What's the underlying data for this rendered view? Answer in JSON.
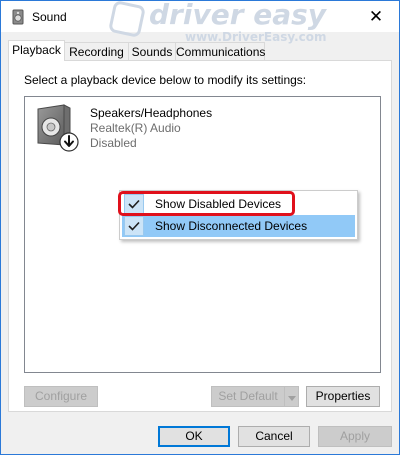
{
  "window": {
    "title": "Sound",
    "close_glyph": "✕"
  },
  "watermark": {
    "brand": "driver easy",
    "url": "www.DriverEasy.com"
  },
  "tabs": [
    {
      "label": "Playback",
      "active": true
    },
    {
      "label": "Recording",
      "active": false
    },
    {
      "label": "Sounds",
      "active": false
    },
    {
      "label": "Communications",
      "active": false
    }
  ],
  "playback": {
    "instruction": "Select a playback device below to modify its settings:",
    "devices": [
      {
        "name": "Speakers/Headphones",
        "driver": "Realtek(R) Audio",
        "status": "Disabled",
        "icon": "speaker-icon"
      }
    ]
  },
  "context_menu": {
    "items": [
      {
        "label": "Show Disabled Devices",
        "checked": true
      },
      {
        "label": "Show Disconnected Devices",
        "checked": true
      }
    ]
  },
  "panel_buttons": {
    "configure": "Configure",
    "set_default": "Set Default",
    "properties": "Properties"
  },
  "dialog_buttons": {
    "ok": "OK",
    "cancel": "Cancel",
    "apply": "Apply"
  },
  "colors": {
    "accent": "#0078d7",
    "highlight_ring": "#e0101b",
    "menu_check_bg": "#cce4f7"
  }
}
